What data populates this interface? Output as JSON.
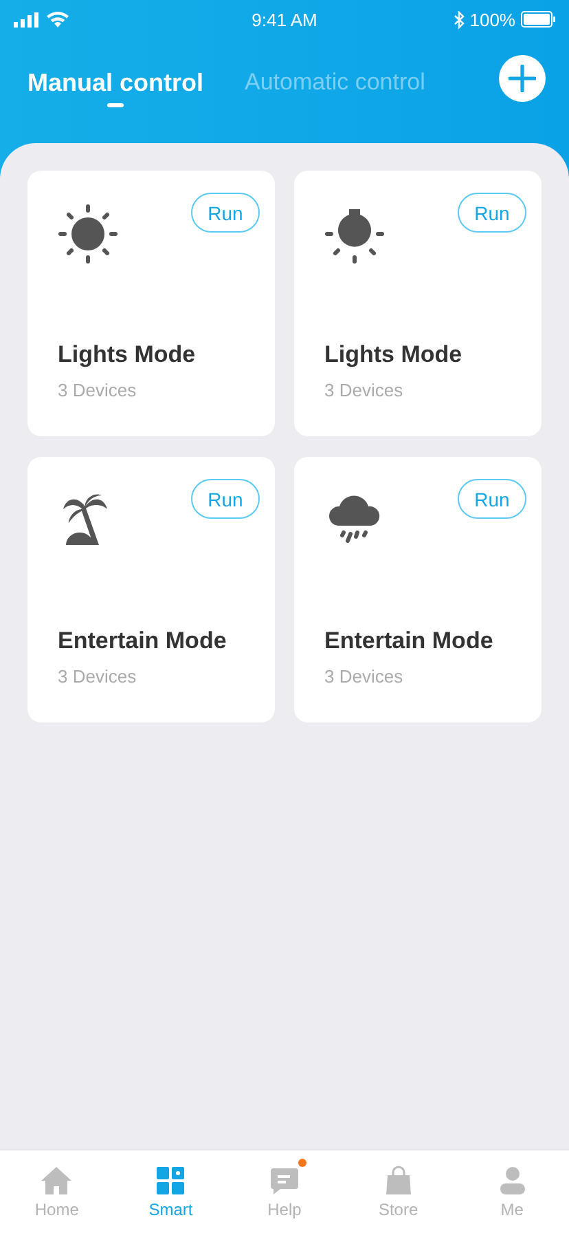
{
  "status_bar": {
    "time": "9:41 AM",
    "battery": "100%"
  },
  "tabs": [
    {
      "label": "Manual control",
      "selected": true
    },
    {
      "label": "Automatic control",
      "selected": false
    }
  ],
  "modes": [
    {
      "kind": "sun",
      "button": "Run",
      "title": "Lights Mode",
      "subtitle": "3 Devices"
    },
    {
      "kind": "bulb",
      "button": "Run",
      "title": "Lights Mode",
      "subtitle": "3 Devices"
    },
    {
      "kind": "palm",
      "button": "Run",
      "title": "Entertain Mode",
      "subtitle": "3 Devices"
    },
    {
      "kind": "rain",
      "button": "Run",
      "title": "Entertain Mode",
      "subtitle": "3 Devices"
    }
  ],
  "nav": [
    {
      "kind": "home",
      "label": "Home",
      "selected": false,
      "badge": false
    },
    {
      "kind": "grid",
      "label": "Smart",
      "selected": true,
      "badge": false
    },
    {
      "kind": "chat",
      "label": "Help",
      "selected": false,
      "badge": true
    },
    {
      "kind": "bag",
      "label": "Store",
      "selected": false,
      "badge": false
    },
    {
      "kind": "person",
      "label": "Me",
      "selected": false,
      "badge": false
    }
  ]
}
